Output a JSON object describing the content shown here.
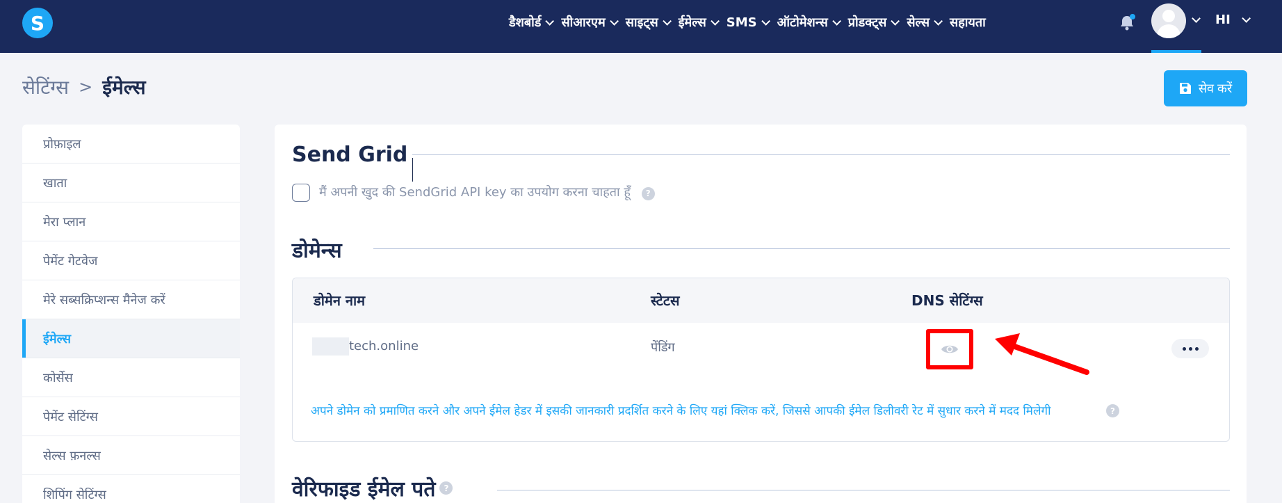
{
  "app": {
    "logo_letter": "S"
  },
  "nav": {
    "items": [
      {
        "label": "डैशबोर्ड",
        "has_dropdown": true
      },
      {
        "label": "सीआरएम",
        "has_dropdown": true
      },
      {
        "label": "साइट्स",
        "has_dropdown": true
      },
      {
        "label": "ईमेल्स",
        "has_dropdown": true
      },
      {
        "label": "SMS",
        "has_dropdown": true
      },
      {
        "label": "ऑटोमेशन्स",
        "has_dropdown": true
      },
      {
        "label": "प्रोडक्ट्स",
        "has_dropdown": true
      },
      {
        "label": "सेल्स",
        "has_dropdown": true
      },
      {
        "label": "सहायता",
        "has_dropdown": false
      }
    ],
    "language": "HI",
    "bell_icon": "bell-icon",
    "avatar_icon": "user-avatar-icon"
  },
  "breadcrumb": {
    "parent": "सेटिंग्स",
    "separator": ">",
    "current": "ईमेल्स"
  },
  "toolbar": {
    "save_label": "सेव करें",
    "save_icon": "floppy-disk-icon"
  },
  "sidebar": {
    "items": [
      {
        "label": "प्रोफ़ाइल",
        "active": false
      },
      {
        "label": "खाता",
        "active": false
      },
      {
        "label": "मेरा प्लान",
        "active": false
      },
      {
        "label": "पेमेंट गेटवेज",
        "active": false
      },
      {
        "label": "मेरे सब्सक्रिप्शन्स मैनेज करें",
        "active": false
      },
      {
        "label": "ईमेल्स",
        "active": true
      },
      {
        "label": "कोर्सेस",
        "active": false
      },
      {
        "label": "पेमेंट सेटिंग्स",
        "active": false
      },
      {
        "label": "सेल्स फ़नल्स",
        "active": false
      },
      {
        "label": "शिपिंग सेटिंग्स",
        "active": false
      }
    ]
  },
  "sendgrid": {
    "title": "Send Grid",
    "checkbox_label": "मैं अपनी खुद की SendGrid API key का उपयोग करना चाहता हूँ",
    "checked": false,
    "help_symbol": "?"
  },
  "domains": {
    "title": "डोमेन्स",
    "columns": [
      "डोमेन नाम",
      "स्टेटस",
      "DNS सेटिंग्स"
    ],
    "rows": [
      {
        "domain": "tech.online",
        "status": "पेंडिंग",
        "dns_icon": "eye-icon"
      }
    ],
    "info_text": "अपने डोमेन को प्रमाणित करने और अपने ईमेल हेडर में इसकी जानकारी प्रदर्शित करने के लिए यहां क्लिक करें, जिससे आपकी ईमेल डिलीवरी रेट में सुधार करने में मदद मिलेगी",
    "help_symbol": "?"
  },
  "verified": {
    "title": "वेरिफाइड ईमेल पते",
    "help_symbol": "?"
  },
  "colors": {
    "nav_bg": "#1a2a5c",
    "accent": "#1ea7f6",
    "highlight": "#ff0000",
    "page_bg": "#f3f4f8"
  }
}
